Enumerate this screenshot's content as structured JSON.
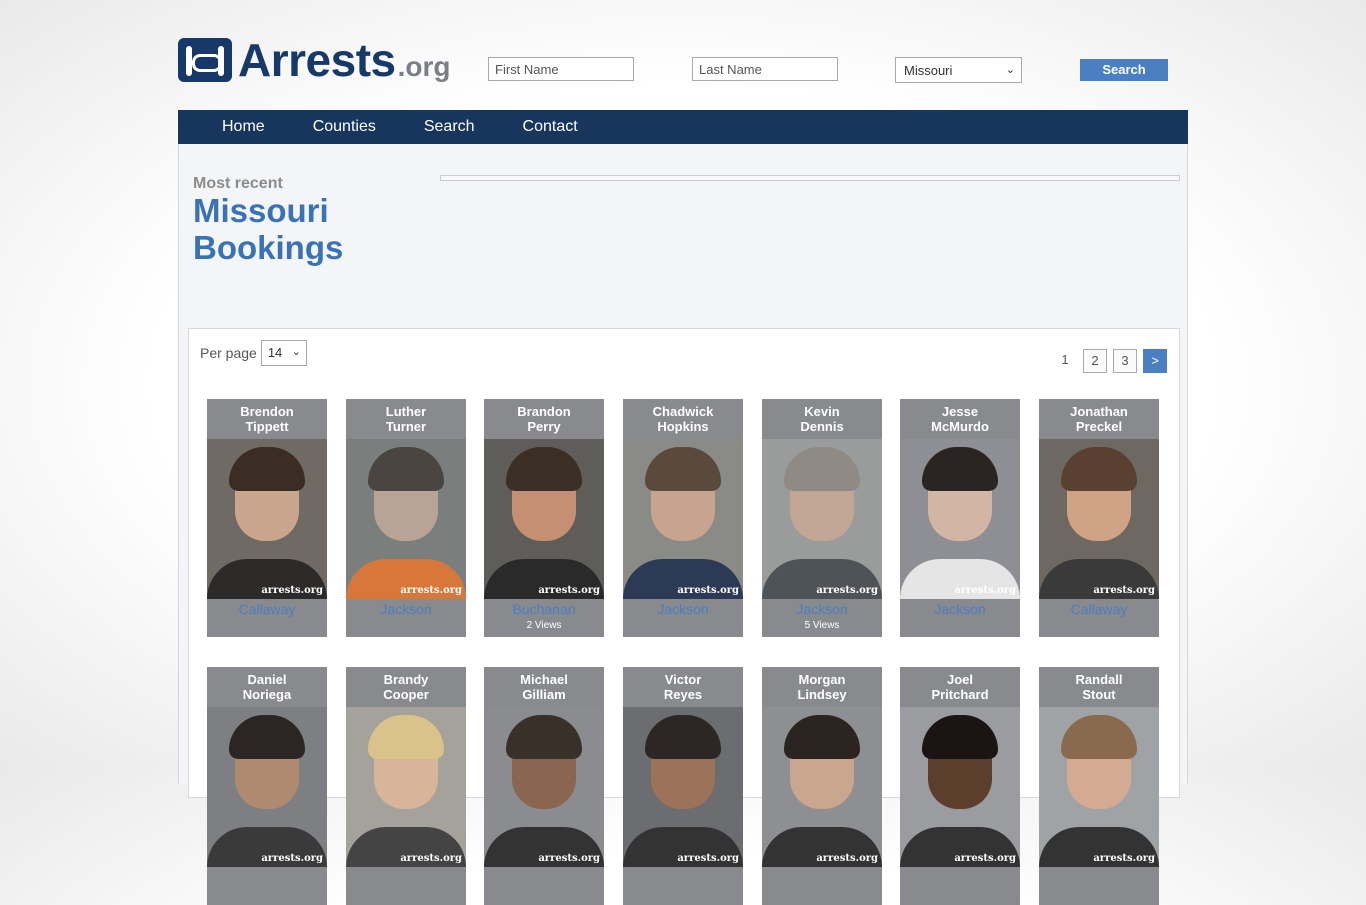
{
  "site": {
    "logo_main": "Arrests",
    "logo_tld": ".org"
  },
  "search": {
    "first_placeholder": "First Name",
    "last_placeholder": "Last Name",
    "state": "Missouri",
    "button": "Search"
  },
  "nav": [
    "Home",
    "Counties",
    "Search",
    "Contact"
  ],
  "page": {
    "kicker": "Most recent",
    "heading_line1": "Missouri",
    "heading_line2": "Bookings"
  },
  "per_page": {
    "label": "Per page",
    "value": "14"
  },
  "pagination": {
    "current": "1",
    "pages": [
      "2",
      "3"
    ],
    "next": ">"
  },
  "watermark": "arrests.org",
  "bookings": [
    {
      "first": "Brendon",
      "last": "Tippett",
      "county": "Callaway",
      "views": "",
      "bg": "#6f6a63",
      "skin": "#c9a58e",
      "hair": "#3b2d23",
      "shirt": "#2c2b2a"
    },
    {
      "first": "Luther",
      "last": "Turner",
      "county": "Jackson",
      "views": "",
      "bg": "#7a7f7e",
      "skin": "#b9a396",
      "hair": "#4a4540",
      "shirt": "#d8773a"
    },
    {
      "first": "Brandon",
      "last": "Perry",
      "county": "Buchanan",
      "views": "2 Views",
      "bg": "#5f5d5a",
      "skin": "#c48f73",
      "hair": "#3c2f26",
      "shirt": "#2a2a2a"
    },
    {
      "first": "Chadwick",
      "last": "Hopkins",
      "county": "Jackson",
      "views": "",
      "bg": "#8a8a86",
      "skin": "#c7a48f",
      "hair": "#5b4a3c",
      "shirt": "#2c3a55"
    },
    {
      "first": "Kevin",
      "last": "Dennis",
      "county": "Jackson",
      "views": "5 Views",
      "bg": "#9a9c9b",
      "skin": "#c2a796",
      "hair": "#8f8a84",
      "shirt": "#4e5358"
    },
    {
      "first": "Jesse",
      "last": "McMurdo",
      "county": "Jackson",
      "views": "",
      "bg": "#8d8f94",
      "skin": "#d2b5a4",
      "hair": "#2a2522",
      "shirt": "#e5e5e5"
    },
    {
      "first": "Jonathan",
      "last": "Preckel",
      "county": "Callaway",
      "views": "",
      "bg": "#6d6962",
      "skin": "#d0a286",
      "hair": "#5a4030",
      "shirt": "#3a3a3a"
    },
    {
      "first": "Daniel",
      "last": "Noriega",
      "county": "",
      "views": "",
      "bg": "#7d7f82",
      "skin": "#b08a6e",
      "hair": "#2b2623",
      "shirt": "#3a3a3a"
    },
    {
      "first": "Brandy",
      "last": "Cooper",
      "county": "",
      "views": "",
      "bg": "#a5a29c",
      "skin": "#d8b59a",
      "hair": "#d9c38a",
      "shirt": "#444"
    },
    {
      "first": "Michael",
      "last": "Gilliam",
      "county": "",
      "views": "",
      "bg": "#8a8c8f",
      "skin": "#8a6650",
      "hair": "#3a302a",
      "shirt": "#333"
    },
    {
      "first": "Victor",
      "last": "Reyes",
      "county": "",
      "views": "",
      "bg": "#6b6d70",
      "skin": "#9c7258",
      "hair": "#2c2724",
      "shirt": "#333"
    },
    {
      "first": "Morgan",
      "last": "Lindsey",
      "county": "",
      "views": "",
      "bg": "#8d8f93",
      "skin": "#c9a68e",
      "hair": "#2b2420",
      "shirt": "#333"
    },
    {
      "first": "Joel",
      "last": "Pritchard",
      "county": "",
      "views": "",
      "bg": "#9a9ca0",
      "skin": "#5d3d2b",
      "hair": "#1a1412",
      "shirt": "#333"
    },
    {
      "first": "Randall",
      "last": "Stout",
      "county": "",
      "views": "",
      "bg": "#a0a3a6",
      "skin": "#d4ab92",
      "hair": "#8a6a4e",
      "shirt": "#333"
    }
  ]
}
